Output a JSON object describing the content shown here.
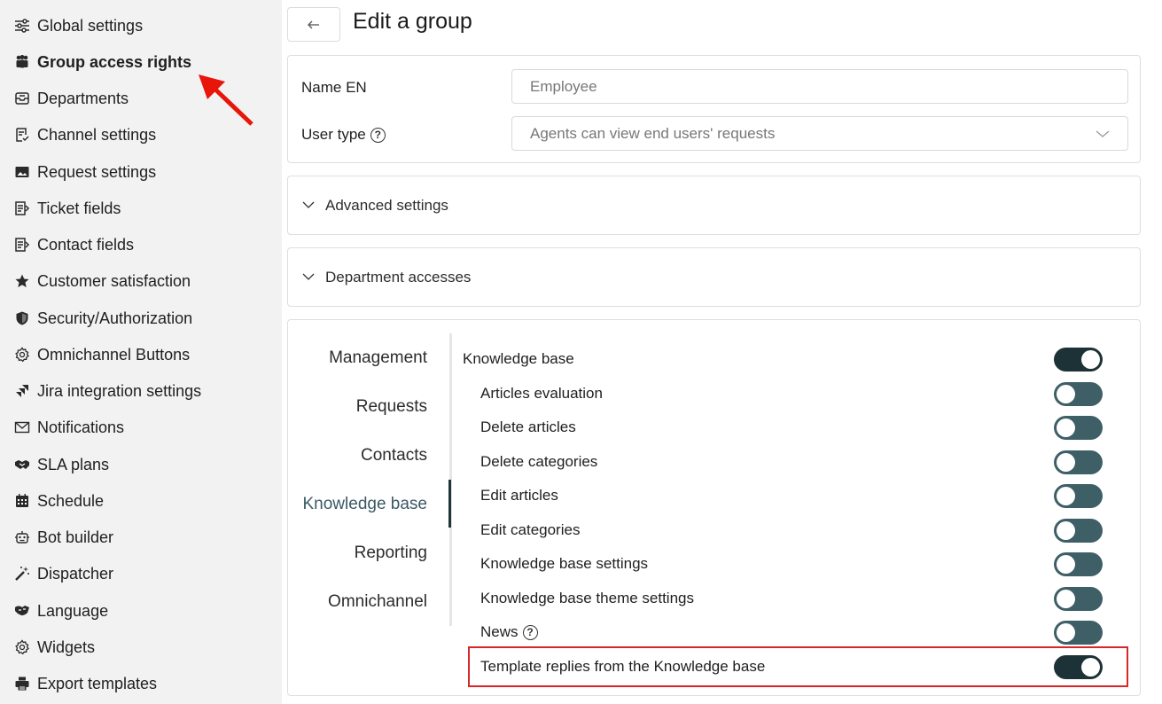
{
  "sidebar": {
    "items": [
      {
        "label": "Global settings",
        "icon": "sliders-icon"
      },
      {
        "label": "Group access rights",
        "icon": "group-icon",
        "active": true
      },
      {
        "label": "Departments",
        "icon": "inbox-icon"
      },
      {
        "label": "Channel settings",
        "icon": "checklist-icon"
      },
      {
        "label": "Request settings",
        "icon": "image-icon"
      },
      {
        "label": "Ticket fields",
        "icon": "fields-icon"
      },
      {
        "label": "Contact fields",
        "icon": "fields-icon"
      },
      {
        "label": "Customer satisfaction",
        "icon": "star-icon"
      },
      {
        "label": "Security/Authorization",
        "icon": "shield-icon"
      },
      {
        "label": "Omnichannel Buttons",
        "icon": "gear-icon"
      },
      {
        "label": "Jira integration settings",
        "icon": "jira-icon"
      },
      {
        "label": "Notifications",
        "icon": "envelope-icon"
      },
      {
        "label": "SLA plans",
        "icon": "handshake-icon"
      },
      {
        "label": "Schedule",
        "icon": "calendar-icon"
      },
      {
        "label": "Bot builder",
        "icon": "robot-icon"
      },
      {
        "label": "Dispatcher",
        "icon": "magic-wand-icon"
      },
      {
        "label": "Language",
        "icon": "language-icon"
      },
      {
        "label": "Widgets",
        "icon": "gear-icon"
      },
      {
        "label": "Export templates",
        "icon": "printer-icon"
      }
    ]
  },
  "header": {
    "title": "Edit a group"
  },
  "form": {
    "name_label": "Name EN",
    "name_value": "Employee",
    "user_type_label": "User type",
    "user_type_value": "Agents can view end users' requests"
  },
  "sections": {
    "advanced": "Advanced settings",
    "department": "Department accesses"
  },
  "tabs": [
    {
      "label": "Management"
    },
    {
      "label": "Requests"
    },
    {
      "label": "Contacts"
    },
    {
      "label": "Knowledge base",
      "active": true
    },
    {
      "label": "Reporting"
    },
    {
      "label": "Omnichannel"
    }
  ],
  "permissions": [
    {
      "label": "Knowledge base",
      "enabled": true,
      "level": "parent"
    },
    {
      "label": "Articles evaluation",
      "enabled": false,
      "level": "sub"
    },
    {
      "label": "Delete articles",
      "enabled": false,
      "level": "sub"
    },
    {
      "label": "Delete categories",
      "enabled": false,
      "level": "sub"
    },
    {
      "label": "Edit articles",
      "enabled": false,
      "level": "sub"
    },
    {
      "label": "Edit categories",
      "enabled": false,
      "level": "sub"
    },
    {
      "label": "Knowledge base settings",
      "enabled": false,
      "level": "sub"
    },
    {
      "label": "Knowledge base theme settings",
      "enabled": false,
      "level": "sub"
    },
    {
      "label": "News",
      "enabled": false,
      "level": "sub",
      "help": true
    },
    {
      "label": "Template replies from the Knowledge base",
      "enabled": true,
      "level": "sub",
      "highlighted": true
    }
  ],
  "colors": {
    "toggle_on": "#1d3236",
    "toggle_off": "#3e5f66",
    "highlight": "#d62828",
    "active_tab": "#3c5a66"
  }
}
